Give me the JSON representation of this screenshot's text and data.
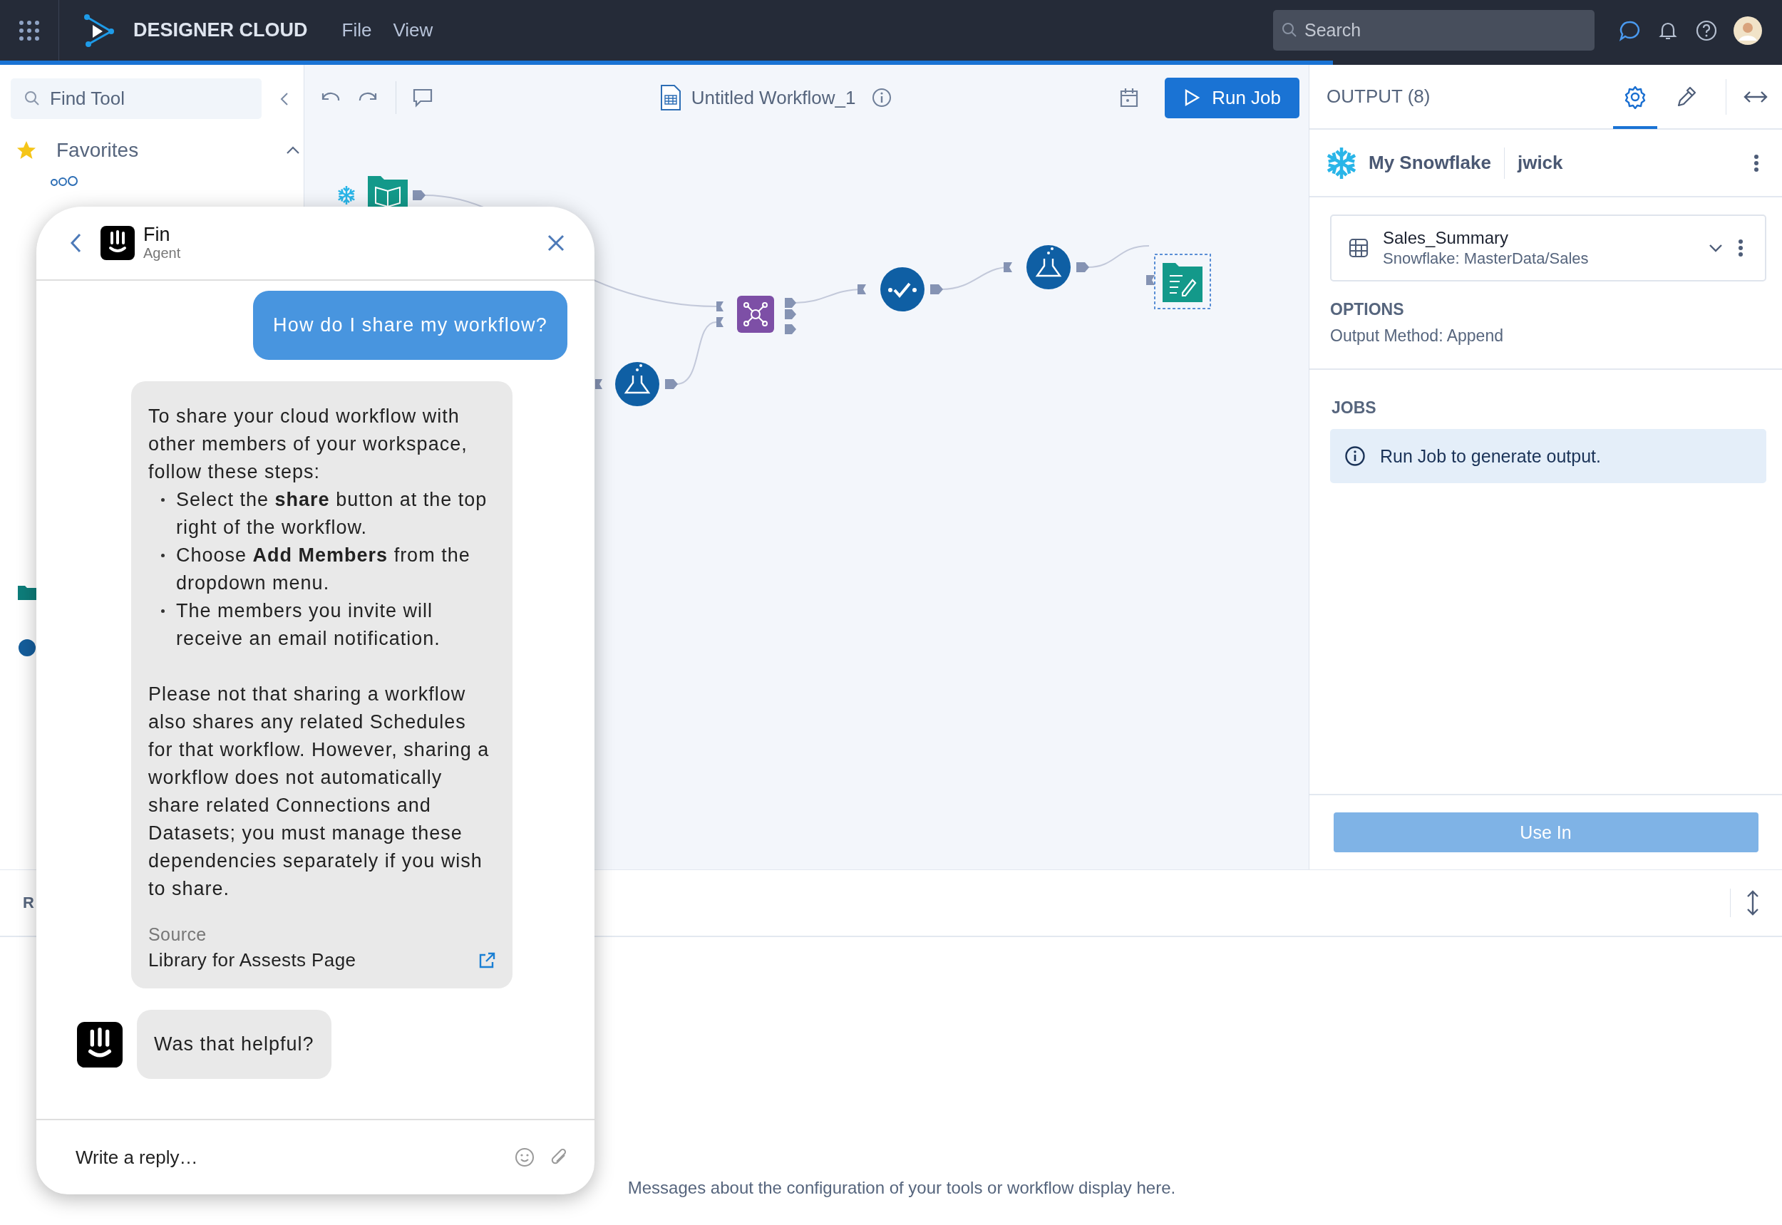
{
  "top_bar": {
    "app_name": "DESIGNER CLOUD",
    "menu": [
      "File",
      "View"
    ],
    "search": {
      "placeholder": "Search"
    }
  },
  "tool_sidebar": {
    "search": {
      "placeholder": "Find Tool"
    },
    "section": {
      "label": "Favorites",
      "expanded": true
    }
  },
  "canvas": {
    "title": "Untitled Workflow_1",
    "run_button": "Run Job"
  },
  "output_panel": {
    "title": "OUTPUT (8)",
    "tabs": [
      {
        "kind": "settings",
        "selected": true
      },
      {
        "kind": "eyedropper",
        "selected": false
      }
    ],
    "connection": {
      "name": "My Snowflake",
      "user": "jwick"
    },
    "dataset": {
      "name": "Sales_Summary",
      "path": "Snowflake: MasterData/Sales"
    },
    "options": {
      "heading": "OPTIONS",
      "text": "Output Method: Append"
    },
    "jobs": {
      "heading": "JOBS",
      "message": "Run Job to generate output."
    },
    "use_button": "Use In"
  },
  "messages_panel": {
    "tab": "R",
    "empty_message": "Messages about the configuration of your tools or workflow display here."
  },
  "chat": {
    "agent_name": "Fin",
    "agent_role": "Agent",
    "messages": [
      {
        "kind": "user",
        "text": "How do I share my workflow?"
      },
      {
        "kind": "answer",
        "intro": "To share your cloud workflow with other members of your workspace, follow these steps:",
        "steps": [
          "Select the **share** button at the top right of the workflow.",
          "Choose **Add Members** from the dropdown menu.",
          "The members you invite will receive an email notification."
        ],
        "note": "Please not that sharing a workflow also shares any related Schedules for that workflow. However, sharing a workflow does not automatically share related Connections and Datasets; you must manage these dependencies separately if you wish to share.",
        "source_label": "Source",
        "source_link": "Library for Assests Page"
      },
      {
        "kind": "bot",
        "text": "Was that helpful?"
      }
    ],
    "reply": {
      "placeholder": "Write a reply…"
    }
  }
}
